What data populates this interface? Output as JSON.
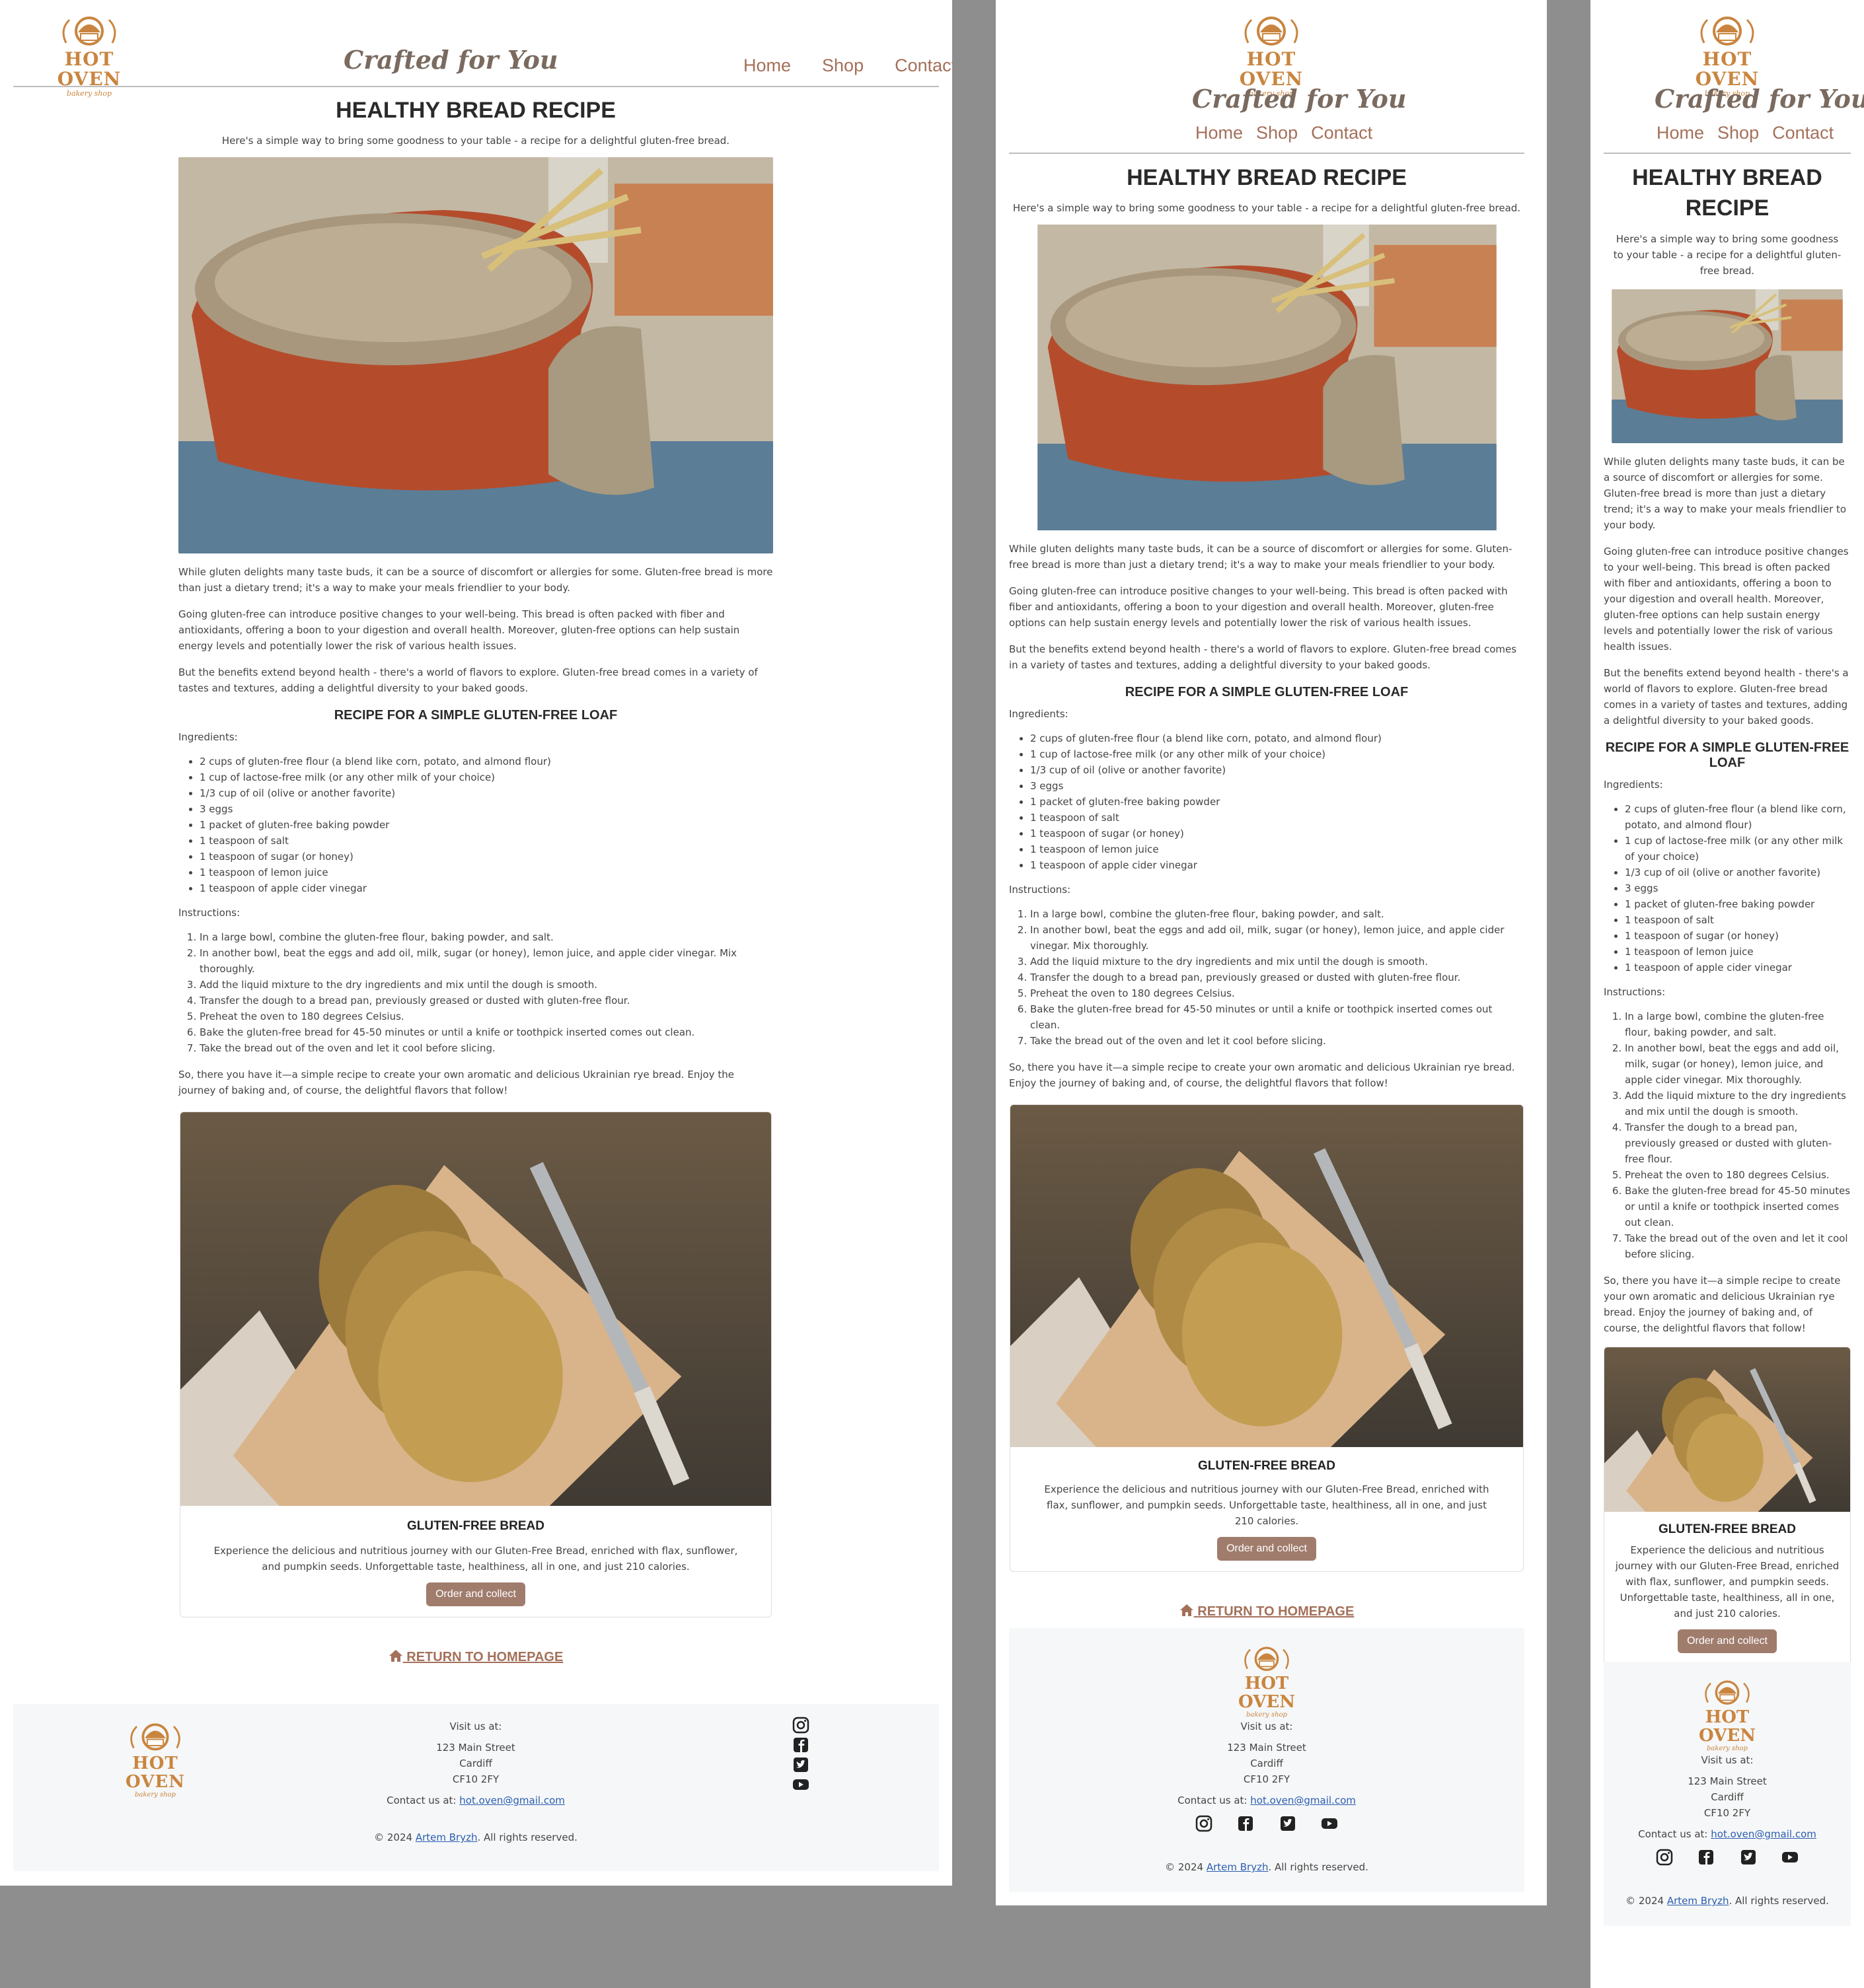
{
  "brand": {
    "name": "HOT OVEN",
    "sub": "bakery shop",
    "tagline": "Crafted for You"
  },
  "nav": {
    "home": "Home",
    "shop": "Shop",
    "contact": "Contact"
  },
  "article": {
    "title": "HEALTHY BREAD RECIPE",
    "intro": "Here's a simple way to bring some goodness to your table - a recipe for a delightful gluten-free bread.",
    "paragraphs": [
      "While gluten delights many taste buds, it can be a source of discomfort or allergies for some. Gluten-free bread is more than just a dietary trend; it's a way to make your meals friendlier to your body.",
      "Going gluten-free can introduce positive changes to your well-being. This bread is often packed with fiber and antioxidants, offering a boon to your digestion and overall health. Moreover, gluten-free options can help sustain energy levels and potentially lower the risk of various health issues.",
      "But the benefits extend beyond health - there's a world of flavors to explore. Gluten-free bread comes in a variety of tastes and textures, adding a delightful diversity to your baked goods."
    ],
    "recipe_title": "RECIPE FOR A SIMPLE GLUTEN-FREE LOAF",
    "ingredients_label": "Ingredients:",
    "ingredients": [
      "2 cups of gluten-free flour (a blend like corn, potato, and almond flour)",
      "1 cup of lactose-free milk (or any other milk of your choice)",
      "1/3 cup of oil (olive or another favorite)",
      "3 eggs",
      "1 packet of gluten-free baking powder",
      "1 teaspoon of salt",
      "1 teaspoon of sugar (or honey)",
      "1 teaspoon of lemon juice",
      "1 teaspoon of apple cider vinegar"
    ],
    "instructions_label": "Instructions:",
    "instructions": [
      "In a large bowl, combine the gluten-free flour, baking powder, and salt.",
      "In another bowl, beat the eggs and add oil, milk, sugar (or honey), lemon juice, and apple cider vinegar. Mix thoroughly.",
      "Add the liquid mixture to the dry ingredients and mix until the dough is smooth.",
      "Transfer the dough to a bread pan, previously greased or dusted with gluten-free flour.",
      "Preheat the oven to 180 degrees Celsius.",
      "Bake the gluten-free bread for 45-50 minutes or until a knife or toothpick inserted comes out clean.",
      "Take the bread out of the oven and let it cool before slicing."
    ],
    "closing": "So, there you have it—a simple recipe to create your own aromatic and delicious Ukrainian rye bread. Enjoy the journey of baking and, of course, the delightful flavors that follow!"
  },
  "card": {
    "title": "GLUTEN-FREE BREAD",
    "desc": "Experience the delicious and nutritious journey with our Gluten-Free Bread, enriched with flax, sunflower, and pumpkin seeds. Unforgettable taste, healthiness, all in one, and just 210 calories.",
    "button": "Order and collect"
  },
  "return_link": "RETURN TO HOMEPAGE",
  "footer": {
    "visit": "Visit us at:",
    "address": [
      "123 Main Street",
      "Cardiff",
      "CF10 2FY"
    ],
    "contact_label": "Contact us at: ",
    "email": "hot.oven@gmail.com",
    "copy_pre": "© 2024 ",
    "author": "Artem Bryzh",
    "copy_post": ". All rights reserved."
  },
  "icons": [
    "instagram-icon",
    "facebook-icon",
    "twitter-icon",
    "youtube-icon"
  ],
  "colors": {
    "accent": "#a4705a",
    "button": "#a07c6d",
    "logo": "#c9853f",
    "link": "#2a5db0",
    "footer_bg": "#f6f7f8"
  }
}
